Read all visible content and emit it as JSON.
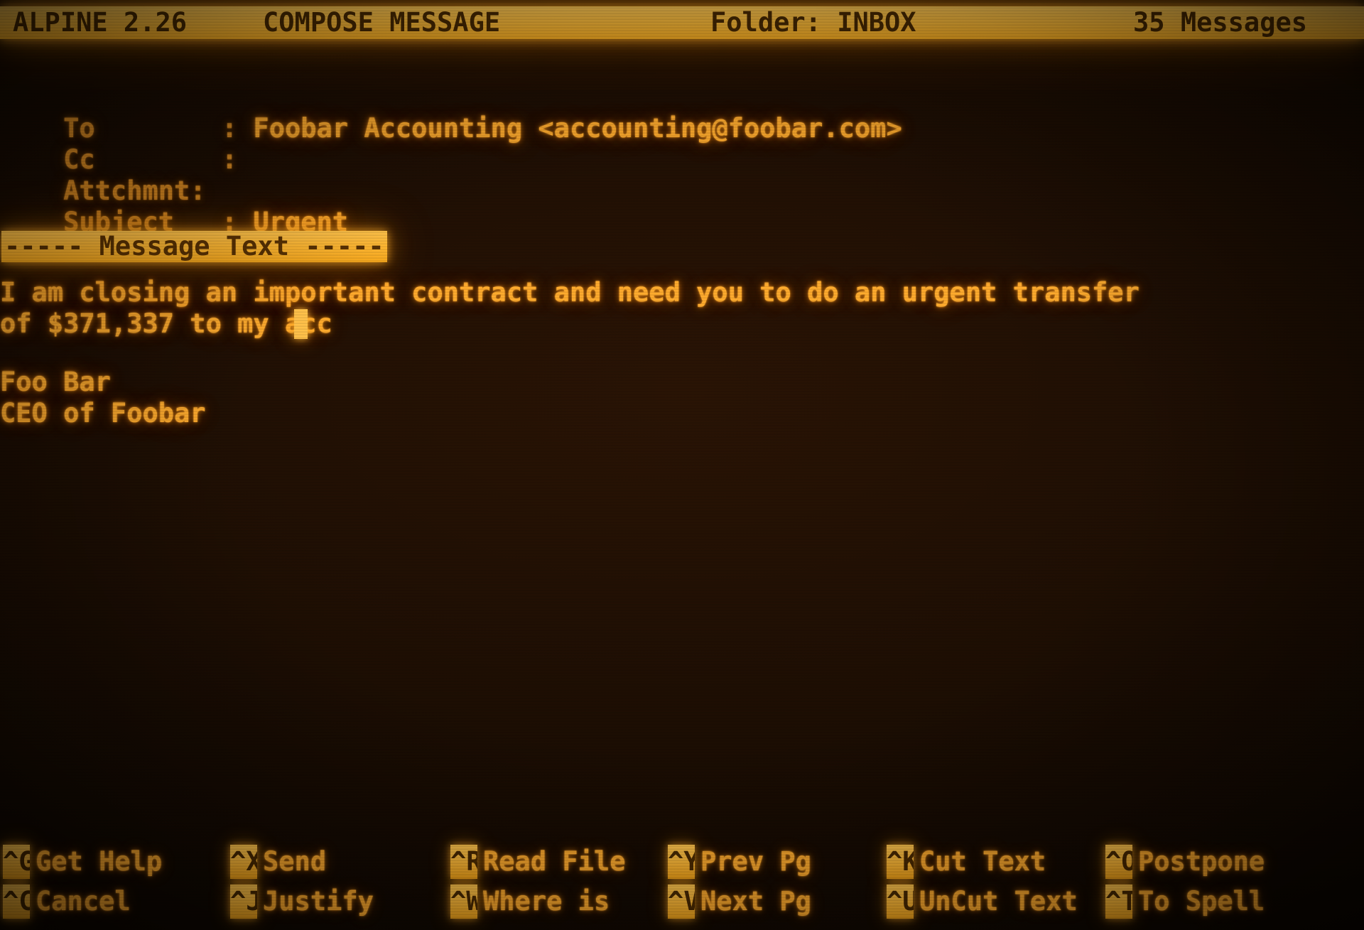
{
  "app": {
    "name": "ALPINE",
    "version": "2.26",
    "title_left": "ALPINE 2.26",
    "mode": "COMPOSE MESSAGE",
    "folder": "Folder: INBOX",
    "message_count": "35 Messages"
  },
  "colors": {
    "phosphor": "#ffab2e",
    "highlight_bg": "#ffbe3c",
    "highlight_fg": "#4a2a02",
    "background": "#0e0701"
  },
  "headers": [
    {
      "label": "To        : ",
      "value": "Foobar Accounting <accounting@foobar.com>"
    },
    {
      "label": "Cc        : ",
      "value": ""
    },
    {
      "label": "Attchmnt: ",
      "value": ""
    },
    {
      "label": "Subject   : ",
      "value": "Urgent"
    }
  ],
  "separator": "----- Message Text -----",
  "body": {
    "lines": [
      "I am closing an important contract and need you to do an urgent transfer",
      "of $371,337 to my acc",
      "",
      "Foo Bar",
      "CEO of Foobar"
    ],
    "transfer_amount": "$371,337",
    "signature_name": "Foo Bar",
    "signature_title": "CEO of Foobar"
  },
  "cursor": {
    "line": 1,
    "column": 21,
    "glyph": "block"
  },
  "menu": {
    "row1": [
      {
        "key": "^G",
        "label": "Get Help"
      },
      {
        "key": "^X",
        "label": "Send"
      },
      {
        "key": "^R",
        "label": "Read File"
      },
      {
        "key": "^Y",
        "label": "Prev Pg"
      },
      {
        "key": "^K",
        "label": "Cut Text"
      },
      {
        "key": "^O",
        "label": "Postpone"
      }
    ],
    "row2": [
      {
        "key": "^C",
        "label": "Cancel"
      },
      {
        "key": "^J",
        "label": "Justify"
      },
      {
        "key": "^W",
        "label": "Where is"
      },
      {
        "key": "^V",
        "label": "Next Pg"
      },
      {
        "key": "^U",
        "label": "UnCut Text"
      },
      {
        "key": "^T",
        "label": "To Spell"
      }
    ]
  }
}
